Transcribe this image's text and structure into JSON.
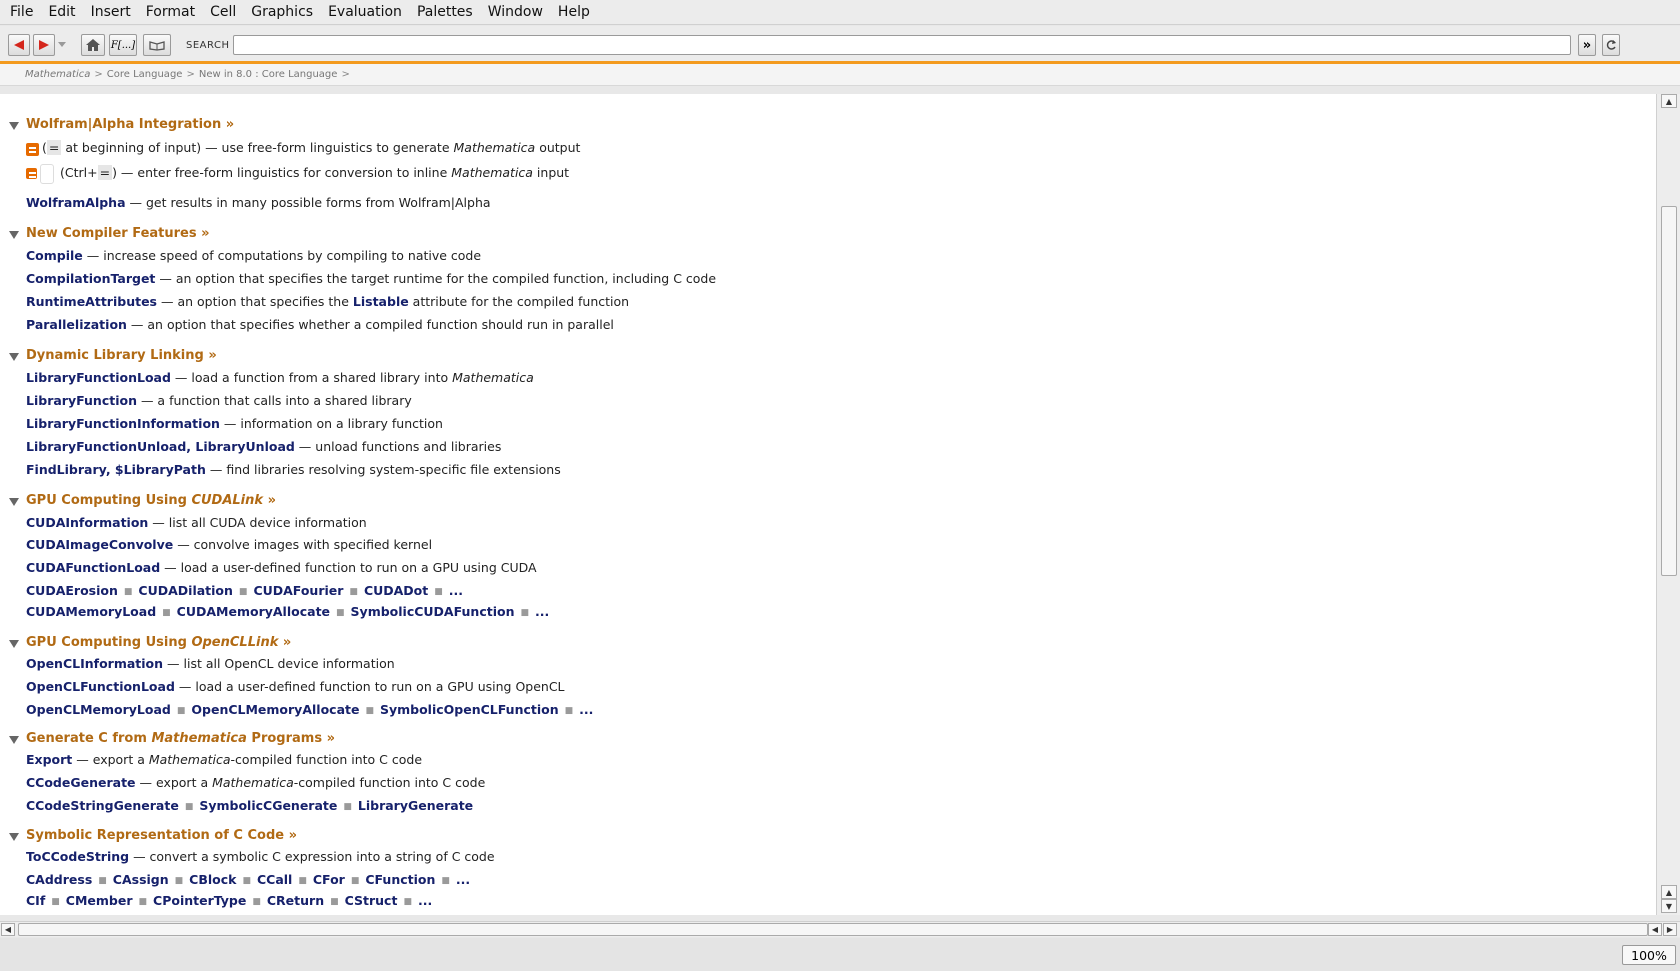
{
  "menu": [
    "File",
    "Edit",
    "Insert",
    "Format",
    "Cell",
    "Graphics",
    "Evaluation",
    "Palettes",
    "Window",
    "Help"
  ],
  "toolbar": {
    "function_label": "F[...]",
    "search_label": "SEARCH",
    "search_value": "",
    "go_label": "»"
  },
  "breadcrumb": [
    "Mathematica",
    "Core Language",
    "New in 8.0 : Core Language"
  ],
  "sections": {
    "s1": {
      "title": "Wolfram|Alpha Integration »"
    },
    "s2": {
      "title": "New Compiler Features »"
    },
    "s3": {
      "title": "Dynamic Library Linking »"
    },
    "s4": {
      "title_pre": "GPU Computing Using ",
      "title_it": "CUDALink",
      "title_post": " »"
    },
    "s5": {
      "title_pre": "GPU Computing Using ",
      "title_it": "OpenCLLink",
      "title_post": " »"
    },
    "s6": {
      "title_pre": "Generate C from ",
      "title_it": "Mathematica",
      "title_post": " Programs »"
    },
    "s7": {
      "title": "Symbolic Representation of C Code »"
    }
  },
  "wa": {
    "l1_a": "(",
    "l1_key": "=",
    "l1_b": " at beginning of input) — use free-form linguistics to generate ",
    "l1_it": "Mathematica",
    "l1_c": " output",
    "l2_a": "(Ctrl+",
    "l2_key": "=",
    "l2_b": ") — enter free-form linguistics for conversion to inline ",
    "l2_it": "Mathematica",
    "l2_c": " input",
    "l3_sym": "WolframAlpha",
    "l3_desc": " — get results in many possible forms from Wolfram|Alpha"
  },
  "compiler": [
    {
      "sym": "Compile",
      "desc": " — increase speed of computations by compiling to native code"
    },
    {
      "sym": "CompilationTarget",
      "desc": " — an option that specifies the target runtime for the compiled function, including C code"
    },
    {
      "sym": "RuntimeAttributes",
      "desc_a": " — an option that specifies the ",
      "sym2": "Listable",
      "desc_b": " attribute for the compiled function"
    },
    {
      "sym": "Parallelization",
      "desc": " — an option that specifies whether a compiled function should run in parallel"
    }
  ],
  "dll": [
    {
      "sym": "LibraryFunctionLoad",
      "desc": " — load a function from a shared library into ",
      "it": "Mathematica"
    },
    {
      "sym": "LibraryFunction",
      "desc": " — a function that calls into a shared library"
    },
    {
      "sym": "LibraryFunctionInformation",
      "desc": " — information on a library function"
    },
    {
      "sym": "LibraryFunctionUnload",
      "sep": ", ",
      "sym2": "LibraryUnload",
      "desc": " — unload functions and libraries"
    },
    {
      "sym": "FindLibrary",
      "sep": ", ",
      "sym2": "$LibraryPath",
      "desc": " — find libraries resolving system-specific file extensions"
    }
  ],
  "cuda": {
    "items": [
      {
        "sym": "CUDAInformation",
        "desc": " — list all CUDA device information"
      },
      {
        "sym": "CUDAImageConvolve",
        "desc": " — convolve images with specified kernel"
      },
      {
        "sym": "CUDAFunctionLoad",
        "desc": " — load a user-defined function to run on a GPU using CUDA"
      }
    ],
    "row1": [
      "CUDAErosion",
      "CUDADilation",
      "CUDAFourier",
      "CUDADot",
      "..."
    ],
    "row2": [
      "CUDAMemoryLoad",
      "CUDAMemoryAllocate",
      "SymbolicCUDAFunction",
      "..."
    ]
  },
  "opencl": {
    "items": [
      {
        "sym": "OpenCLInformation",
        "desc": " — list all OpenCL device information"
      },
      {
        "sym": "OpenCLFunctionLoad",
        "desc": " — load a user-defined function to run on a GPU using OpenCL"
      }
    ],
    "row1": [
      "OpenCLMemoryLoad",
      "OpenCLMemoryAllocate",
      "SymbolicOpenCLFunction",
      "..."
    ]
  },
  "genc": {
    "items": [
      {
        "sym": "Export",
        "desc_a": " — export a ",
        "it": "Mathematica",
        "desc_b": "-compiled function into C code"
      },
      {
        "sym": "CCodeGenerate",
        "desc_a": " — export a ",
        "it": "Mathematica",
        "desc_b": "-compiled function into C code"
      }
    ],
    "row1": [
      "CCodeStringGenerate",
      "SymbolicCGenerate",
      "LibraryGenerate"
    ]
  },
  "symc": {
    "items": [
      {
        "sym": "ToCCodeString",
        "desc": " — convert a symbolic C expression into a string of C code"
      }
    ],
    "row1": [
      "CAddress",
      "CAssign",
      "CBlock",
      "CCall",
      "CFor",
      "CFunction",
      "..."
    ],
    "row2": [
      "CIf",
      "CMember",
      "CPointerType",
      "CReturn",
      "CStruct",
      "..."
    ]
  },
  "status": {
    "zoom": "100%"
  }
}
